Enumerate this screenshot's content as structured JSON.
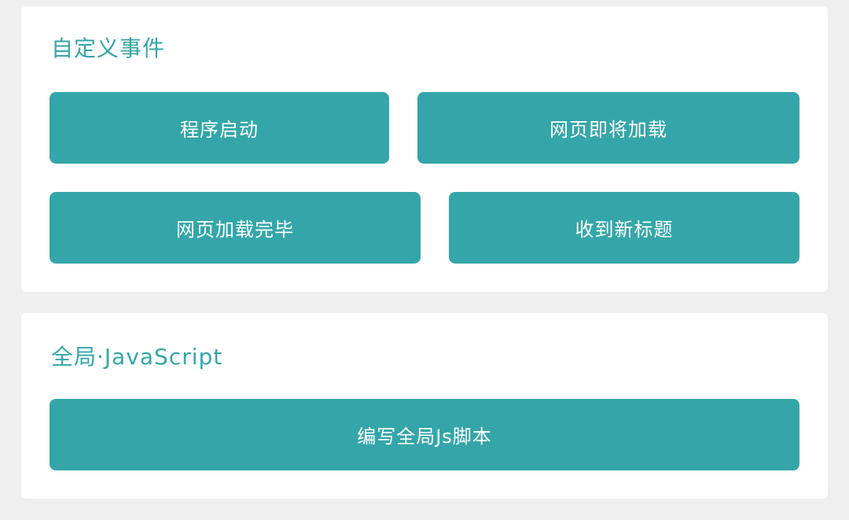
{
  "custom_events": {
    "title": "自定义事件",
    "buttons": {
      "app_start": "程序启动",
      "page_will_load": "网页即将加载",
      "page_loaded": "网页加载完毕",
      "new_title": "收到新标题"
    }
  },
  "global_js": {
    "title": "全局·JavaScript",
    "button": "编写全局Js脚本"
  },
  "colors": {
    "accent": "#34a6a9",
    "background": "#efefef",
    "card": "#ffffff"
  }
}
